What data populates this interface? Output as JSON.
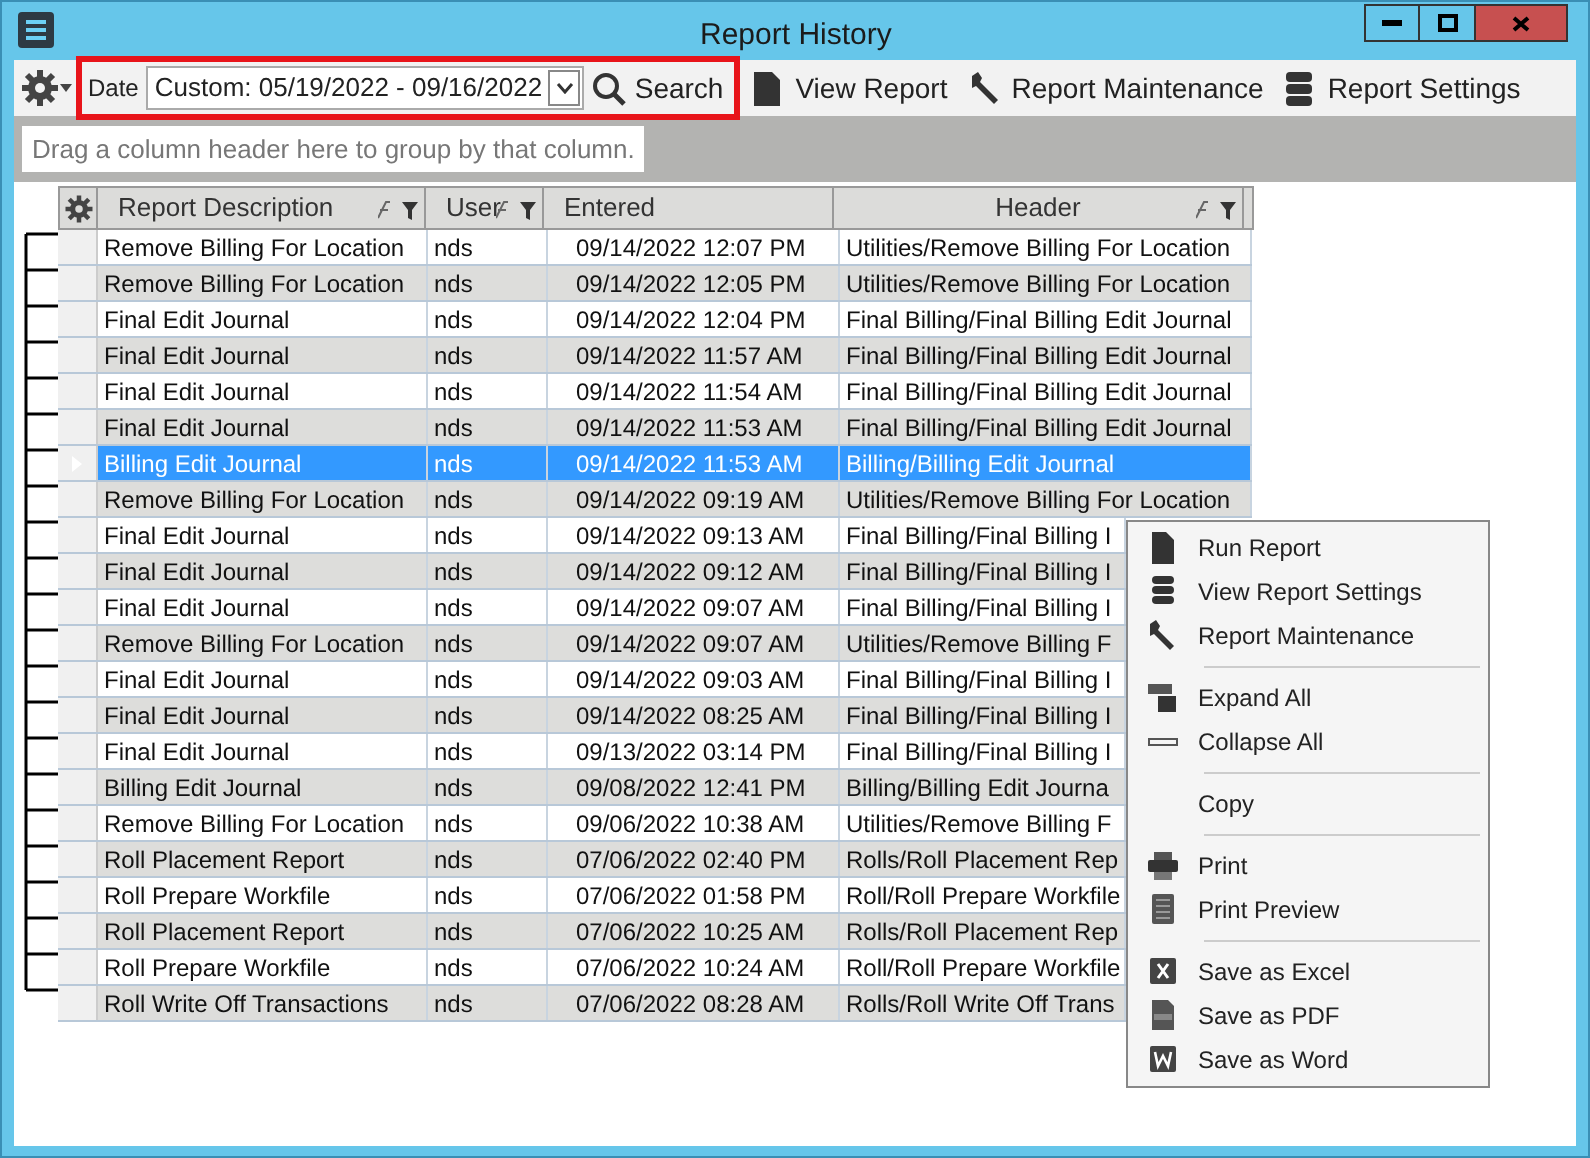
{
  "window": {
    "title": "Report History"
  },
  "toolbar": {
    "date_label": "Date",
    "date_range": "Custom: 05/19/2022 - 09/16/2022",
    "search": "Search",
    "view_report": "View Report",
    "report_maintenance": "Report Maintenance",
    "report_settings": "Report Settings"
  },
  "group_panel": {
    "placeholder": "Drag a column header here to group by that column."
  },
  "table": {
    "columns": [
      "Report Description",
      "User",
      "Entered",
      "Header"
    ],
    "rows": [
      {
        "description": "Remove Billing For Location",
        "user": "nds",
        "entered": "09/14/2022 12:07 PM",
        "header": "Utilities/Remove Billing For Location",
        "selected": false
      },
      {
        "description": "Remove Billing For Location",
        "user": "nds",
        "entered": "09/14/2022 12:05 PM",
        "header": "Utilities/Remove Billing For Location",
        "selected": false
      },
      {
        "description": "Final Edit Journal",
        "user": "nds",
        "entered": "09/14/2022 12:04 PM",
        "header": "Final Billing/Final Billing Edit Journal",
        "selected": false
      },
      {
        "description": "Final Edit Journal",
        "user": "nds",
        "entered": "09/14/2022 11:57 AM",
        "header": "Final Billing/Final Billing Edit Journal",
        "selected": false
      },
      {
        "description": "Final Edit Journal",
        "user": "nds",
        "entered": "09/14/2022 11:54 AM",
        "header": "Final Billing/Final Billing Edit Journal",
        "selected": false
      },
      {
        "description": "Final Edit Journal",
        "user": "nds",
        "entered": "09/14/2022 11:53 AM",
        "header": "Final Billing/Final Billing Edit Journal",
        "selected": false
      },
      {
        "description": "Billing Edit Journal",
        "user": "nds",
        "entered": "09/14/2022 11:53 AM",
        "header": "Billing/Billing Edit Journal",
        "selected": true
      },
      {
        "description": "Remove Billing For Location",
        "user": "nds",
        "entered": "09/14/2022 09:19 AM",
        "header": "Utilities/Remove Billing For Location",
        "selected": false
      },
      {
        "description": "Final Edit Journal",
        "user": "nds",
        "entered": "09/14/2022 09:13 AM",
        "header": "Final Billing/Final Billing I",
        "selected": false
      },
      {
        "description": "Final Edit Journal",
        "user": "nds",
        "entered": "09/14/2022 09:12 AM",
        "header": "Final Billing/Final Billing I",
        "selected": false
      },
      {
        "description": "Final Edit Journal",
        "user": "nds",
        "entered": "09/14/2022 09:07 AM",
        "header": "Final Billing/Final Billing I",
        "selected": false
      },
      {
        "description": "Remove Billing For Location",
        "user": "nds",
        "entered": "09/14/2022 09:07 AM",
        "header": "Utilities/Remove Billing F",
        "selected": false
      },
      {
        "description": "Final Edit Journal",
        "user": "nds",
        "entered": "09/14/2022 09:03 AM",
        "header": "Final Billing/Final Billing I",
        "selected": false
      },
      {
        "description": "Final Edit Journal",
        "user": "nds",
        "entered": "09/14/2022 08:25 AM",
        "header": "Final Billing/Final Billing I",
        "selected": false
      },
      {
        "description": "Final Edit Journal",
        "user": "nds",
        "entered": "09/13/2022 03:14 PM",
        "header": "Final Billing/Final Billing I",
        "selected": false
      },
      {
        "description": "Billing Edit Journal",
        "user": "nds",
        "entered": "09/08/2022 12:41 PM",
        "header": "Billing/Billing Edit Journa",
        "selected": false
      },
      {
        "description": "Remove Billing For Location",
        "user": "nds",
        "entered": "09/06/2022 10:38 AM",
        "header": "Utilities/Remove Billing F",
        "selected": false
      },
      {
        "description": "Roll Placement Report",
        "user": "nds",
        "entered": "07/06/2022 02:40 PM",
        "header": "Rolls/Roll Placement Rep",
        "selected": false
      },
      {
        "description": "Roll Prepare Workfile",
        "user": "nds",
        "entered": "07/06/2022 01:58 PM",
        "header": "Roll/Roll Prepare Workfile",
        "selected": false
      },
      {
        "description": "Roll Placement Report",
        "user": "nds",
        "entered": "07/06/2022 10:25 AM",
        "header": "Rolls/Roll Placement Rep",
        "selected": false
      },
      {
        "description": "Roll Prepare Workfile",
        "user": "nds",
        "entered": "07/06/2022 10:24 AM",
        "header": "Roll/Roll Prepare Workfile",
        "selected": false
      },
      {
        "description": "Roll Write Off Transactions",
        "user": "nds",
        "entered": "07/06/2022 08:28 AM",
        "header": "Rolls/Roll Write Off Trans",
        "selected": false
      }
    ]
  },
  "context_menu": {
    "groups": [
      [
        "Run Report",
        "View Report Settings",
        "Report Maintenance"
      ],
      [
        "Expand All",
        "Collapse All"
      ],
      [
        "Copy"
      ],
      [
        "Print",
        "Print Preview"
      ],
      [
        "Save as Excel",
        "Save as PDF",
        "Save as Word"
      ]
    ]
  }
}
